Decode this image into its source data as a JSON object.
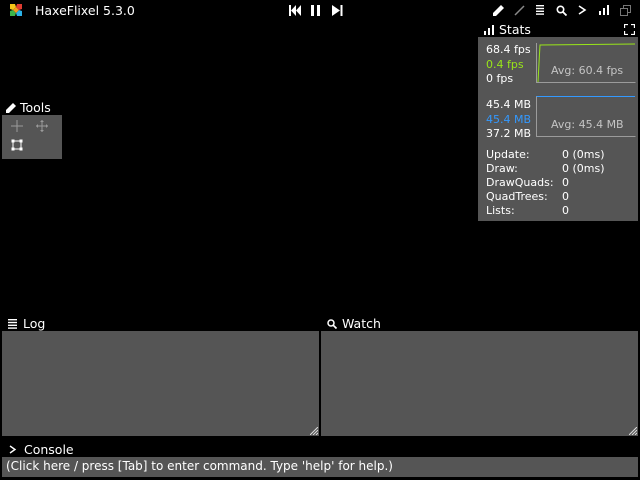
{
  "title_bar": {
    "app_title": "HaxeFlixel 5.3.0",
    "logo_icon": "haxeflixel-logo-icon",
    "playback": [
      "rewind-icon",
      "pause-icon",
      "step-forward-icon"
    ],
    "toolbar_icons": [
      "draw-debug-icon",
      "line-icon",
      "log-icon",
      "watch-icon",
      "console-icon",
      "stats-icon",
      "windows-icon"
    ]
  },
  "tools": {
    "header": "Tools",
    "items": [
      "pointer-tool-icon",
      "mover-tool-icon",
      "transform-tool-icon"
    ]
  },
  "stats": {
    "header": "Stats",
    "fps_current": "68.4 fps",
    "fps_mid": "0.4 fps",
    "fps_min": "0 fps",
    "fps_avg": "Avg: 60.4 fps",
    "mem_max": "45.4 MB",
    "mem_current": "45.4 MB",
    "mem_min": "37.2 MB",
    "mem_avg": "Avg: 45.4 MB",
    "rows": [
      {
        "label": "Update:",
        "value": "0 (0ms)"
      },
      {
        "label": "Draw:",
        "value": "0 (0ms)"
      },
      {
        "label": "DrawQuads:",
        "value": "0"
      },
      {
        "label": "QuadTrees:",
        "value": "0"
      },
      {
        "label": "Lists:",
        "value": "0"
      }
    ]
  },
  "log": {
    "header": "Log"
  },
  "watch": {
    "header": "Watch"
  },
  "console": {
    "header": "Console",
    "input_text": "(Click here / press [Tab] to enter command. Type 'help' for help.)"
  },
  "colors": {
    "panel": "#555555",
    "fps_green": "#99e619",
    "mem_blue": "#3399ff",
    "graph_gray": "#9b9b9b"
  }
}
